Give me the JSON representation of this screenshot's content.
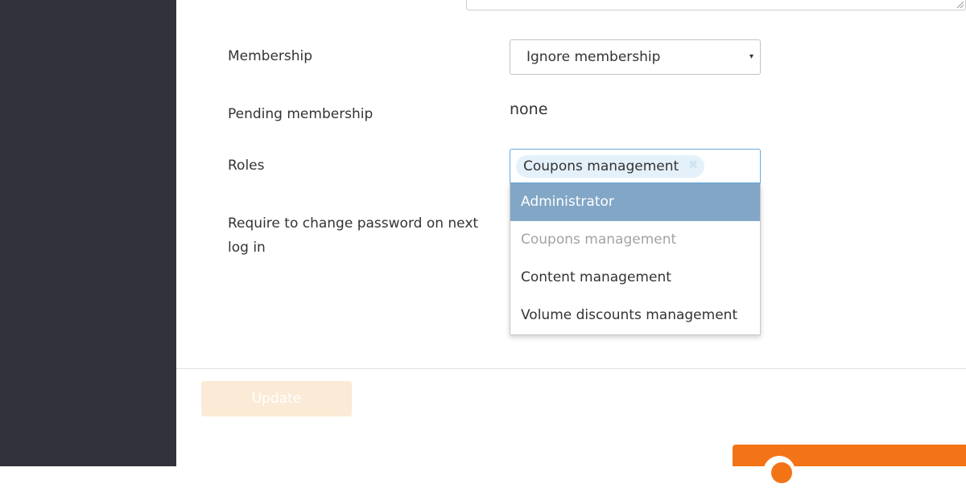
{
  "form": {
    "membership": {
      "label": "Membership",
      "selected": "Ignore membership",
      "caret": "▾"
    },
    "pending_membership": {
      "label": "Pending membership",
      "value": "none"
    },
    "roles": {
      "label": "Roles",
      "selected_tags": [
        "Coupons management"
      ],
      "tag_remove_glyph": "✖",
      "options": [
        {
          "label": "Administrator",
          "state": "highlighted"
        },
        {
          "label": "Coupons management",
          "state": "disabled"
        },
        {
          "label": "Content management",
          "state": "normal"
        },
        {
          "label": "Volume discounts management",
          "state": "normal"
        }
      ]
    },
    "require_password_change": {
      "label": "Require to change password on next log in"
    },
    "update_button": {
      "label": "Update"
    }
  },
  "colors": {
    "sidebar": "#31313b",
    "highlight": "#82a6c6",
    "tag_bg": "#e4f1fb",
    "button_disabled": "#fbead5",
    "chat_widget": "#f27417"
  },
  "icons": {
    "resize_grip": "resize-grip-icon",
    "chat": "chat-icon"
  }
}
